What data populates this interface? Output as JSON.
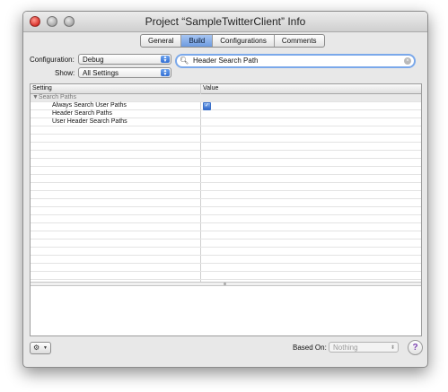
{
  "window": {
    "title": "Project “SampleTwitterClient” Info"
  },
  "tabs": [
    {
      "label": "General",
      "active": false
    },
    {
      "label": "Build",
      "active": true
    },
    {
      "label": "Configurations",
      "active": false
    },
    {
      "label": "Comments",
      "active": false
    }
  ],
  "configuration": {
    "label": "Configuration:",
    "value": "Debug"
  },
  "show": {
    "label": "Show:",
    "value": "All Settings"
  },
  "search": {
    "value": "Header Search Path"
  },
  "table": {
    "columns": [
      "Setting",
      "Value"
    ],
    "group": "▼Search Paths",
    "rows": [
      {
        "name": "Always Search User Paths",
        "checked": true
      },
      {
        "name": "Header Search Paths",
        "checked": false
      },
      {
        "name": "User Header Search Paths",
        "checked": false
      }
    ]
  },
  "footer": {
    "based_on_label": "Based On:",
    "based_on_value": "Nothing",
    "help": "?"
  },
  "colors": {
    "accent": "#6d9be0",
    "help": "#7a3fb0"
  }
}
